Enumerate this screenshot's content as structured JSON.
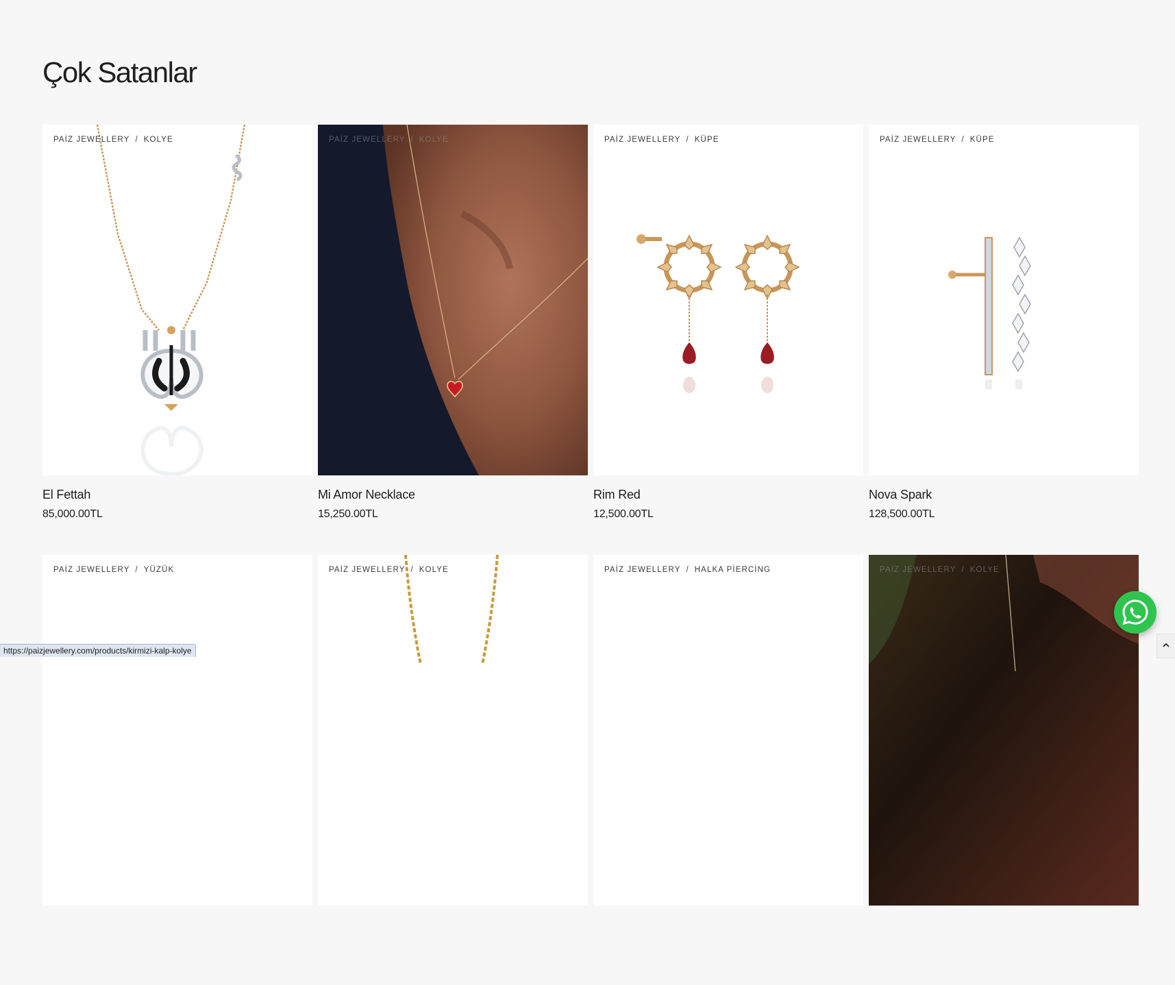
{
  "section": {
    "title": "Çok Satanlar"
  },
  "status_bar": {
    "url": "https://paizjewellery.com/products/kirmizi-kalp-kolye"
  },
  "products": [
    {
      "brand": "PAİZ JEWELLERY",
      "category": "KOLYE",
      "name": "El Fettah",
      "price": "85,000.00TL"
    },
    {
      "brand": "PAİZ JEWELLERY",
      "category": "KOLYE",
      "name": "Mi Amor Necklace",
      "price": "15,250.00TL"
    },
    {
      "brand": "PAİZ JEWELLERY",
      "category": "KÜPE",
      "name": "Rim Red",
      "price": "12,500.00TL"
    },
    {
      "brand": "PAİZ JEWELLERY",
      "category": "KÜPE",
      "name": "Nova Spark",
      "price": "128,500.00TL"
    },
    {
      "brand": "PAİZ JEWELLERY",
      "category": "YÜZÜK"
    },
    {
      "brand": "PAİZ JEWELLERY",
      "category": "KOLYE"
    },
    {
      "brand": "PAİZ JEWELLERY",
      "category": "HALKA PİERCİNG"
    },
    {
      "brand": "PAİZ JEWELLERY",
      "category": "KOLYE"
    }
  ],
  "icons": {
    "whatsapp": "whatsapp-icon",
    "scroll_top": "chevron-up-icon"
  },
  "colors": {
    "background": "#f7f7f7",
    "whatsapp_green": "#2fc44f",
    "gold": "#c9965a",
    "ruby": "#9b1c22"
  }
}
